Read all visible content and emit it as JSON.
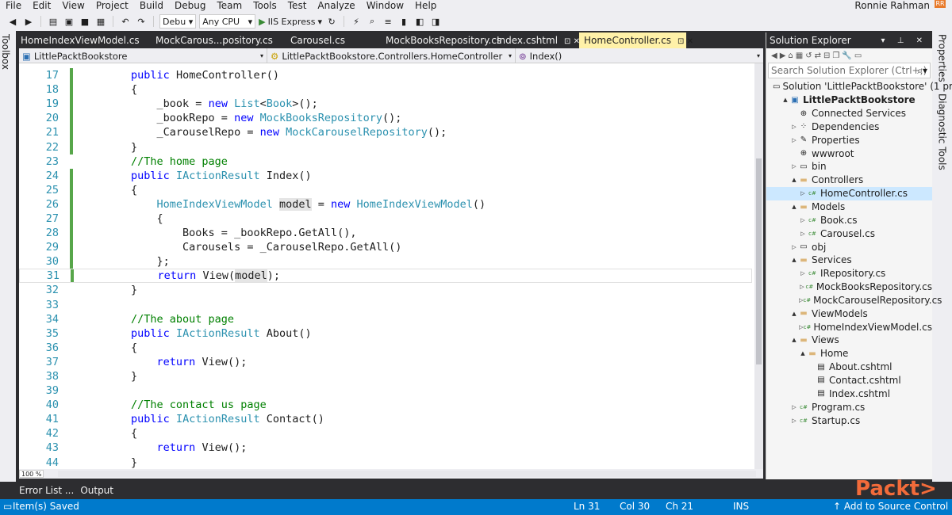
{
  "menubar": {
    "items": [
      "File",
      "Edit",
      "View",
      "Project",
      "Build",
      "Debug",
      "Team",
      "Tools",
      "Test",
      "Analyze",
      "Window",
      "Help"
    ],
    "user": "Ronnie Rahman"
  },
  "toolbar": {
    "config": "Debu",
    "platform": "Any CPU",
    "run_target": "IIS Express"
  },
  "left_strip": {
    "label": "Toolbox"
  },
  "right_strip": {
    "labels": [
      "Properties",
      "Diagnostic Tools"
    ]
  },
  "doc_tabs": [
    {
      "label": "HomeIndexViewModel.cs",
      "active": false
    },
    {
      "label": "MockCarous...pository.cs",
      "active": false
    },
    {
      "label": "Carousel.cs",
      "active": false
    },
    {
      "label": "MockBooksRepository.cs",
      "active": false
    },
    {
      "label": "Index.cshtml",
      "active": false,
      "buttons": "⊡ ✕"
    },
    {
      "label": "HomeController.cs",
      "active": true,
      "buttons": "⊡ ✕"
    }
  ],
  "nav_bar": {
    "project": "LittlePacktBookstore",
    "class": "LittlePacktBookstore.Controllers.HomeController",
    "member": "Index()"
  },
  "editor": {
    "lines": [
      {
        "n": "17",
        "changed": true,
        "code": [
          [
            "t",
            "        "
          ],
          [
            "kw",
            "public "
          ],
          [
            "t",
            "HomeController()"
          ]
        ]
      },
      {
        "n": "18",
        "changed": true,
        "code": [
          [
            "t",
            "        {"
          ]
        ]
      },
      {
        "n": "19",
        "changed": true,
        "code": [
          [
            "t",
            "            _book = "
          ],
          [
            "kw",
            "new "
          ],
          [
            "ty",
            "List"
          ],
          [
            "t",
            "<"
          ],
          [
            "ty",
            "Book"
          ],
          [
            "t",
            ">();"
          ]
        ]
      },
      {
        "n": "20",
        "changed": true,
        "code": [
          [
            "t",
            "            _bookRepo = "
          ],
          [
            "kw",
            "new "
          ],
          [
            "ty",
            "MockBooksRepository"
          ],
          [
            "t",
            "();"
          ]
        ]
      },
      {
        "n": "21",
        "changed": true,
        "code": [
          [
            "t",
            "            _CarouselRepo = "
          ],
          [
            "kw",
            "new "
          ],
          [
            "ty",
            "MockCarouselRepository"
          ],
          [
            "t",
            "();"
          ]
        ]
      },
      {
        "n": "22",
        "changed": true,
        "code": [
          [
            "t",
            "        }"
          ]
        ]
      },
      {
        "n": "23",
        "changed": false,
        "code": [
          [
            "cm",
            "        //The home page"
          ]
        ]
      },
      {
        "n": "24",
        "changed": true,
        "code": [
          [
            "t",
            "        "
          ],
          [
            "kw",
            "public "
          ],
          [
            "ty",
            "IActionResult "
          ],
          [
            "t",
            "Index()"
          ]
        ]
      },
      {
        "n": "25",
        "changed": true,
        "code": [
          [
            "t",
            "        {"
          ]
        ]
      },
      {
        "n": "26",
        "changed": true,
        "code": [
          [
            "t",
            "            "
          ],
          [
            "ty",
            "HomeIndexViewModel "
          ],
          [
            "hl",
            "model"
          ],
          [
            "t",
            " = "
          ],
          [
            "kw",
            "new "
          ],
          [
            "ty",
            "HomeIndexViewModel"
          ],
          [
            "t",
            "()"
          ]
        ]
      },
      {
        "n": "27",
        "changed": true,
        "code": [
          [
            "t",
            "            {"
          ]
        ]
      },
      {
        "n": "28",
        "changed": true,
        "code": [
          [
            "t",
            "                Books = _bookRepo.GetAll(),"
          ]
        ]
      },
      {
        "n": "29",
        "changed": true,
        "code": [
          [
            "t",
            "                Carousels = _CarouselRepo.GetAll()"
          ]
        ]
      },
      {
        "n": "30",
        "changed": true,
        "code": [
          [
            "t",
            "            };"
          ]
        ]
      },
      {
        "n": "31",
        "changed": true,
        "current": true,
        "code": [
          [
            "t",
            "            "
          ],
          [
            "kw",
            "return "
          ],
          [
            "t",
            "View("
          ],
          [
            "hl",
            "model"
          ],
          [
            "t",
            ");"
          ]
        ]
      },
      {
        "n": "32",
        "changed": false,
        "code": [
          [
            "t",
            "        }"
          ]
        ]
      },
      {
        "n": "33",
        "changed": false,
        "code": [
          [
            "t",
            ""
          ]
        ]
      },
      {
        "n": "34",
        "changed": false,
        "code": [
          [
            "cm",
            "        //The about page"
          ]
        ]
      },
      {
        "n": "35",
        "changed": false,
        "code": [
          [
            "t",
            "        "
          ],
          [
            "kw",
            "public "
          ],
          [
            "ty",
            "IActionResult "
          ],
          [
            "t",
            "About()"
          ]
        ]
      },
      {
        "n": "36",
        "changed": false,
        "code": [
          [
            "t",
            "        {"
          ]
        ]
      },
      {
        "n": "37",
        "changed": false,
        "code": [
          [
            "t",
            "            "
          ],
          [
            "kw",
            "return "
          ],
          [
            "t",
            "View();"
          ]
        ]
      },
      {
        "n": "38",
        "changed": false,
        "code": [
          [
            "t",
            "        }"
          ]
        ]
      },
      {
        "n": "39",
        "changed": false,
        "code": [
          [
            "t",
            ""
          ]
        ]
      },
      {
        "n": "40",
        "changed": false,
        "code": [
          [
            "cm",
            "        //The contact us page"
          ]
        ]
      },
      {
        "n": "41",
        "changed": false,
        "code": [
          [
            "t",
            "        "
          ],
          [
            "kw",
            "public "
          ],
          [
            "ty",
            "IActionResult "
          ],
          [
            "t",
            "Contact()"
          ]
        ]
      },
      {
        "n": "42",
        "changed": false,
        "code": [
          [
            "t",
            "        {"
          ]
        ]
      },
      {
        "n": "43",
        "changed": false,
        "code": [
          [
            "t",
            "            "
          ],
          [
            "kw",
            "return "
          ],
          [
            "t",
            "View();"
          ]
        ]
      },
      {
        "n": "44",
        "changed": false,
        "code": [
          [
            "t",
            "        }"
          ]
        ]
      }
    ],
    "zoom": "100 %"
  },
  "solution_explorer": {
    "title": "Solution Explorer",
    "search_placeholder": "Search Solution Explorer (Ctrl+;)",
    "nodes": [
      {
        "label": "Solution 'LittlePacktBookstore' (1 pr",
        "depth": 0,
        "arrow": "",
        "icon": "solution-icon"
      },
      {
        "label": "LittlePacktBookstore",
        "depth": 1,
        "arrow": "▲",
        "icon": "project-icon",
        "bold": true
      },
      {
        "label": "Connected Services",
        "depth": 2,
        "arrow": "",
        "icon": "connected-services-icon"
      },
      {
        "label": "Dependencies",
        "depth": 2,
        "arrow": "▷",
        "icon": "dependencies-icon"
      },
      {
        "label": "Properties",
        "depth": 2,
        "arrow": "▷",
        "icon": "wrench-icon"
      },
      {
        "label": "wwwroot",
        "depth": 2,
        "arrow": "",
        "icon": "globe-icon"
      },
      {
        "label": "bin",
        "depth": 2,
        "arrow": "▷",
        "icon": "folder-outline-icon"
      },
      {
        "label": "Controllers",
        "depth": 2,
        "arrow": "▲",
        "icon": "folder-icon"
      },
      {
        "label": "HomeController.cs",
        "depth": 3,
        "arrow": "▷",
        "icon": "csharp-file-icon",
        "selected": true
      },
      {
        "label": "Models",
        "depth": 2,
        "arrow": "▲",
        "icon": "folder-icon"
      },
      {
        "label": "Book.cs",
        "depth": 3,
        "arrow": "▷",
        "icon": "csharp-file-icon"
      },
      {
        "label": "Carousel.cs",
        "depth": 3,
        "arrow": "▷",
        "icon": "csharp-file-icon"
      },
      {
        "label": "obj",
        "depth": 2,
        "arrow": "▷",
        "icon": "folder-outline-icon"
      },
      {
        "label": "Services",
        "depth": 2,
        "arrow": "▲",
        "icon": "folder-icon"
      },
      {
        "label": "IRepository.cs",
        "depth": 3,
        "arrow": "▷",
        "icon": "csharp-file-icon"
      },
      {
        "label": "MockBooksRepository.cs",
        "depth": 3,
        "arrow": "▷",
        "icon": "csharp-file-icon"
      },
      {
        "label": "MockCarouselRepository.cs",
        "depth": 3,
        "arrow": "▷",
        "icon": "csharp-file-icon"
      },
      {
        "label": "ViewModels",
        "depth": 2,
        "arrow": "▲",
        "icon": "folder-icon"
      },
      {
        "label": "HomeIndexViewModel.cs",
        "depth": 3,
        "arrow": "▷",
        "icon": "csharp-file-icon"
      },
      {
        "label": "Views",
        "depth": 2,
        "arrow": "▲",
        "icon": "folder-icon"
      },
      {
        "label": "Home",
        "depth": 3,
        "arrow": "▲",
        "icon": "folder-icon"
      },
      {
        "label": "About.cshtml",
        "depth": 4,
        "arrow": "",
        "icon": "cshtml-file-icon"
      },
      {
        "label": "Contact.cshtml",
        "depth": 4,
        "arrow": "",
        "icon": "cshtml-file-icon"
      },
      {
        "label": "Index.cshtml",
        "depth": 4,
        "arrow": "",
        "icon": "cshtml-file-icon"
      },
      {
        "label": "Program.cs",
        "depth": 2,
        "arrow": "▷",
        "icon": "csharp-file-icon"
      },
      {
        "label": "Startup.cs",
        "depth": 2,
        "arrow": "▷",
        "icon": "csharp-file-icon"
      }
    ]
  },
  "bottom_tabs": [
    "Error List ...",
    "Output"
  ],
  "statusbar": {
    "message": "Item(s) Saved",
    "line": "Ln 31",
    "col": "Col 30",
    "ch": "Ch 21",
    "mode": "INS",
    "source_control": "Add to Source Control"
  },
  "watermark": "Packt>",
  "colors": {
    "accent": "#007acc",
    "active_tab": "#fff1a8",
    "keyword": "#0000ff",
    "type": "#2b91af",
    "comment": "#008000"
  }
}
